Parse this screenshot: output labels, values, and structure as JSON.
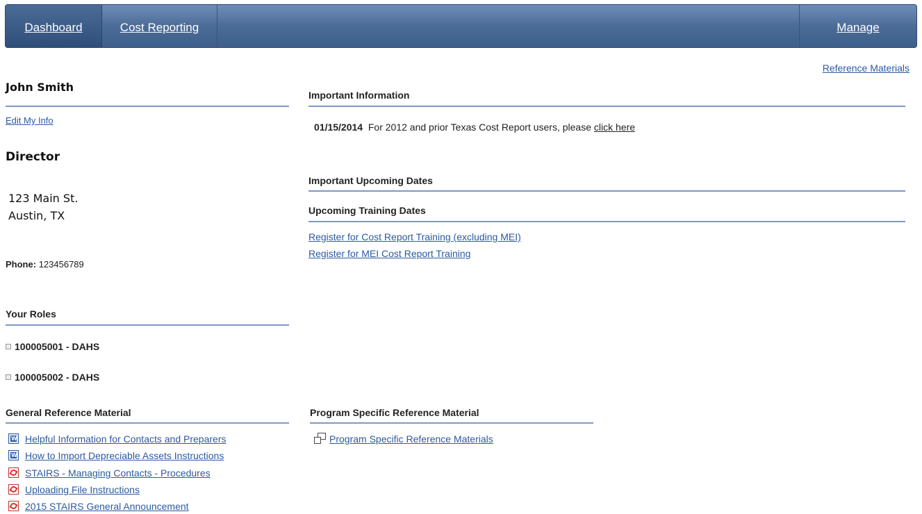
{
  "nav": {
    "dashboard": "Dashboard",
    "cost_reporting": "Cost Reporting",
    "manage": "Manage"
  },
  "reference_materials_link": "Reference Materials",
  "profile": {
    "name": "John Smith",
    "edit_link": "Edit My Info",
    "title": "Director",
    "address_line1": "123 Main St.",
    "address_line2": "Austin, TX",
    "phone_label": "Phone:",
    "phone_value": "123456789"
  },
  "roles": {
    "header": "Your Roles",
    "items": [
      "100005001 - DAHS",
      "100005002 - DAHS"
    ]
  },
  "important_info": {
    "header": "Important Information",
    "date": "01/15/2014",
    "text": "For 2012 and prior Texas Cost Report users, please",
    "link": "click here"
  },
  "upcoming_dates": {
    "header": "Important Upcoming Dates"
  },
  "training": {
    "header": "Upcoming Training Dates",
    "links": [
      "Register for Cost Report Training (excluding MEI)",
      "Register for MEI Cost Report Training"
    ]
  },
  "general_ref": {
    "header": "General Reference Material",
    "items": [
      {
        "label": "Helpful Information for Contacts and Preparers",
        "icon": "word-doc-icon"
      },
      {
        "label": "How to Import Depreciable Assets Instructions",
        "icon": "word-doc-icon"
      },
      {
        "label": "STAIRS - Managing Contacts - Procedures",
        "icon": "pdf-icon"
      },
      {
        "label": "Uploading File Instructions",
        "icon": "pdf-icon"
      },
      {
        "label": "2015 STAIRS General Announcement",
        "icon": "pdf-icon"
      }
    ]
  },
  "program_ref": {
    "header": "Program Specific Reference Material",
    "link": "Program Specific Reference Materials",
    "icon": "new-window-icon"
  },
  "colors": {
    "nav_bg": "#4c6c98",
    "link": "#2b5aa0",
    "rule": "#7f98c3"
  }
}
